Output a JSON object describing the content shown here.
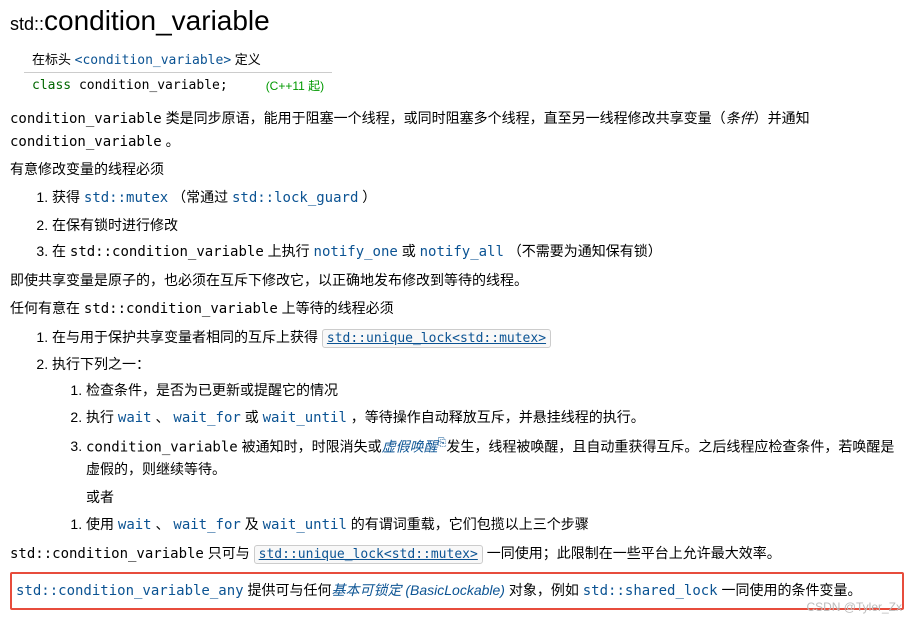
{
  "title": {
    "prefix": "std::",
    "name": "condition_variable"
  },
  "def": {
    "header_prefix": "在标头 ",
    "header_link": "<condition_variable>",
    "header_suffix": " 定义",
    "decl_kw": "class",
    "decl_name": " condition_variable",
    "decl_semi": ";",
    "since": "(C++11 起)"
  },
  "intro": {
    "p1_a": "condition_variable",
    "p1_b": " 类是同步原语，能用于阻塞一个线程，或同时阻塞多个线程，直至另一线程修改共享变量（",
    "p1_c": "条件",
    "p1_d": "）并通知 ",
    "p1_e": "condition_variable",
    "p1_f": " 。"
  },
  "modify": {
    "heading": "有意修改变量的线程必须",
    "li1_a": "获得 ",
    "li1_b": "std::mutex",
    "li1_c": " （常通过 ",
    "li1_link": "std::lock_guard",
    "li1_d": " ）",
    "li2": "在保有锁时进行修改",
    "li3_a": "在 ",
    "li3_b": "std::condition_variable",
    "li3_c": " 上执行 ",
    "li3_link1": "notify_one",
    "li3_d": " 或 ",
    "li3_link2": "notify_all",
    "li3_e": " （不需要为通知保有锁）"
  },
  "atomic": "即使共享变量是原子的，也必须在互斥下修改它，以正确地发布修改到等待的线程。",
  "wait": {
    "heading_a": "任何有意在 ",
    "heading_b": "std::condition_variable",
    "heading_c": " 上等待的线程必须",
    "li1_a": "在与用于保护共享变量者相同的互斥上获得 ",
    "li1_box": "std::unique_lock<std::mutex>",
    "li2": "执行下列之一：",
    "sub1": "检查条件，是否为已更新或提醒它的情况",
    "sub2_a": "执行 ",
    "sub2_link1": "wait",
    "sub2_b": " 、 ",
    "sub2_link2": "wait_for",
    "sub2_c": " 或 ",
    "sub2_link3": "wait_until",
    "sub2_d": " ，等待操作自动释放互斥，并悬挂线程的执行。",
    "sub3_a": "condition_variable",
    "sub3_b": " 被通知时，时限消失或",
    "sub3_link": "虚假唤醒",
    "sub3_c": "发生，线程被唤醒，且自动重获得互斥。之后线程应检查条件，若唤醒是虚假的，则继续等待。",
    "or_label": "或者",
    "alt1_a": "使用 ",
    "alt1_link1": "wait",
    "alt1_b": " 、 ",
    "alt1_link2": "wait_for",
    "alt1_c": " 及 ",
    "alt1_link3": "wait_until",
    "alt1_d": " 的有谓词重载，它们包揽以上三个步骤"
  },
  "footer": {
    "p1_a": "std::condition_variable",
    "p1_b": " 只可与 ",
    "p1_box": "std::unique_lock<std::mutex>",
    "p1_c": " 一同使用；此限制在一些平台上允许最大效率。",
    "p2_link1": "std::condition_variable_any",
    "p2_a": " 提供可与任何",
    "p2_link2": "基本可锁定 (BasicLockable)",
    "p2_b": " 对象，例如 ",
    "p2_link3": "std::shared_lock",
    "p2_c": " 一同使用的条件变量。"
  },
  "watermark": "CSDN @Tyler_Zx"
}
